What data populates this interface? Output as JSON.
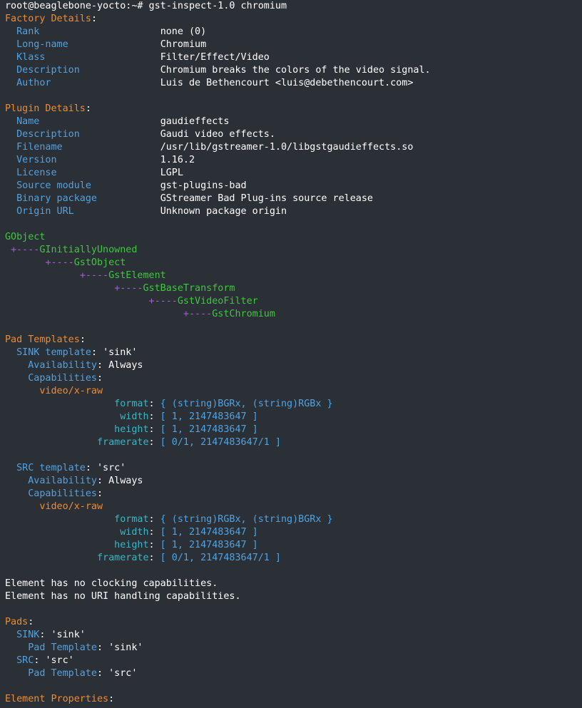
{
  "prompt": "root@beaglebone-yocto:~# ",
  "command": "gst-inspect-1.0 chromium",
  "factory": {
    "heading": "Factory Details",
    "rows": [
      {
        "key": "Rank",
        "value": "none (0)"
      },
      {
        "key": "Long-name",
        "value": "Chromium"
      },
      {
        "key": "Klass",
        "value": "Filter/Effect/Video"
      },
      {
        "key": "Description",
        "value": "Chromium breaks the colors of the video signal."
      },
      {
        "key": "Author",
        "value": "Luis de Bethencourt <luis@debethencourt.com>"
      }
    ]
  },
  "plugin": {
    "heading": "Plugin Details",
    "rows": [
      {
        "key": "Name",
        "value": "gaudieffects"
      },
      {
        "key": "Description",
        "value": "Gaudi video effects."
      },
      {
        "key": "Filename",
        "value": "/usr/lib/gstreamer-1.0/libgstgaudieffects.so"
      },
      {
        "key": "Version",
        "value": "1.16.2"
      },
      {
        "key": "License",
        "value": "LGPL"
      },
      {
        "key": "Source module",
        "value": "gst-plugins-bad"
      },
      {
        "key": "Binary package",
        "value": "GStreamer Bad Plug-ins source release"
      },
      {
        "key": "Origin URL",
        "value": "Unknown package origin"
      }
    ]
  },
  "hierarchy": {
    "root": "GObject",
    "connector": "+----",
    "chain": [
      "GInitiallyUnowned",
      "GstObject",
      "GstElement",
      "GstBaseTransform",
      "GstVideoFilter",
      "GstChromium"
    ]
  },
  "pad_templates": {
    "heading": "Pad Templates",
    "templates": [
      {
        "kind": "SINK template",
        "name": "'sink'",
        "availability_label": "Availability",
        "availability": "Always",
        "capabilities_label": "Capabilities",
        "media": "video/x-raw",
        "caps": {
          "format_label": "format",
          "format": "{ (string)BGRx, (string)RGBx }",
          "width_label": "width",
          "width": "[ 1, 2147483647 ]",
          "height_label": "height",
          "height": "[ 1, 2147483647 ]",
          "framerate_label": "framerate",
          "framerate": "[ 0/1, 2147483647/1 ]"
        }
      },
      {
        "kind": "SRC template",
        "name": "'src'",
        "availability_label": "Availability",
        "availability": "Always",
        "capabilities_label": "Capabilities",
        "media": "video/x-raw",
        "caps": {
          "format_label": "format",
          "format": "{ (string)RGBx, (string)BGRx }",
          "width_label": "width",
          "width": "[ 1, 2147483647 ]",
          "height_label": "height",
          "height": "[ 1, 2147483647 ]",
          "framerate_label": "framerate",
          "framerate": "[ 0/1, 2147483647/1 ]"
        }
      }
    ]
  },
  "notes": [
    "Element has no clocking capabilities.",
    "Element has no URI handling capabilities."
  ],
  "pads": {
    "heading": "Pads",
    "items": [
      {
        "kind": "SINK",
        "name": "'sink'",
        "template_label": "Pad Template",
        "template": "'sink'"
      },
      {
        "kind": "SRC",
        "name": "'src'",
        "template_label": "Pad Template",
        "template": "'src'"
      }
    ]
  },
  "properties": {
    "heading": "Element Properties"
  }
}
